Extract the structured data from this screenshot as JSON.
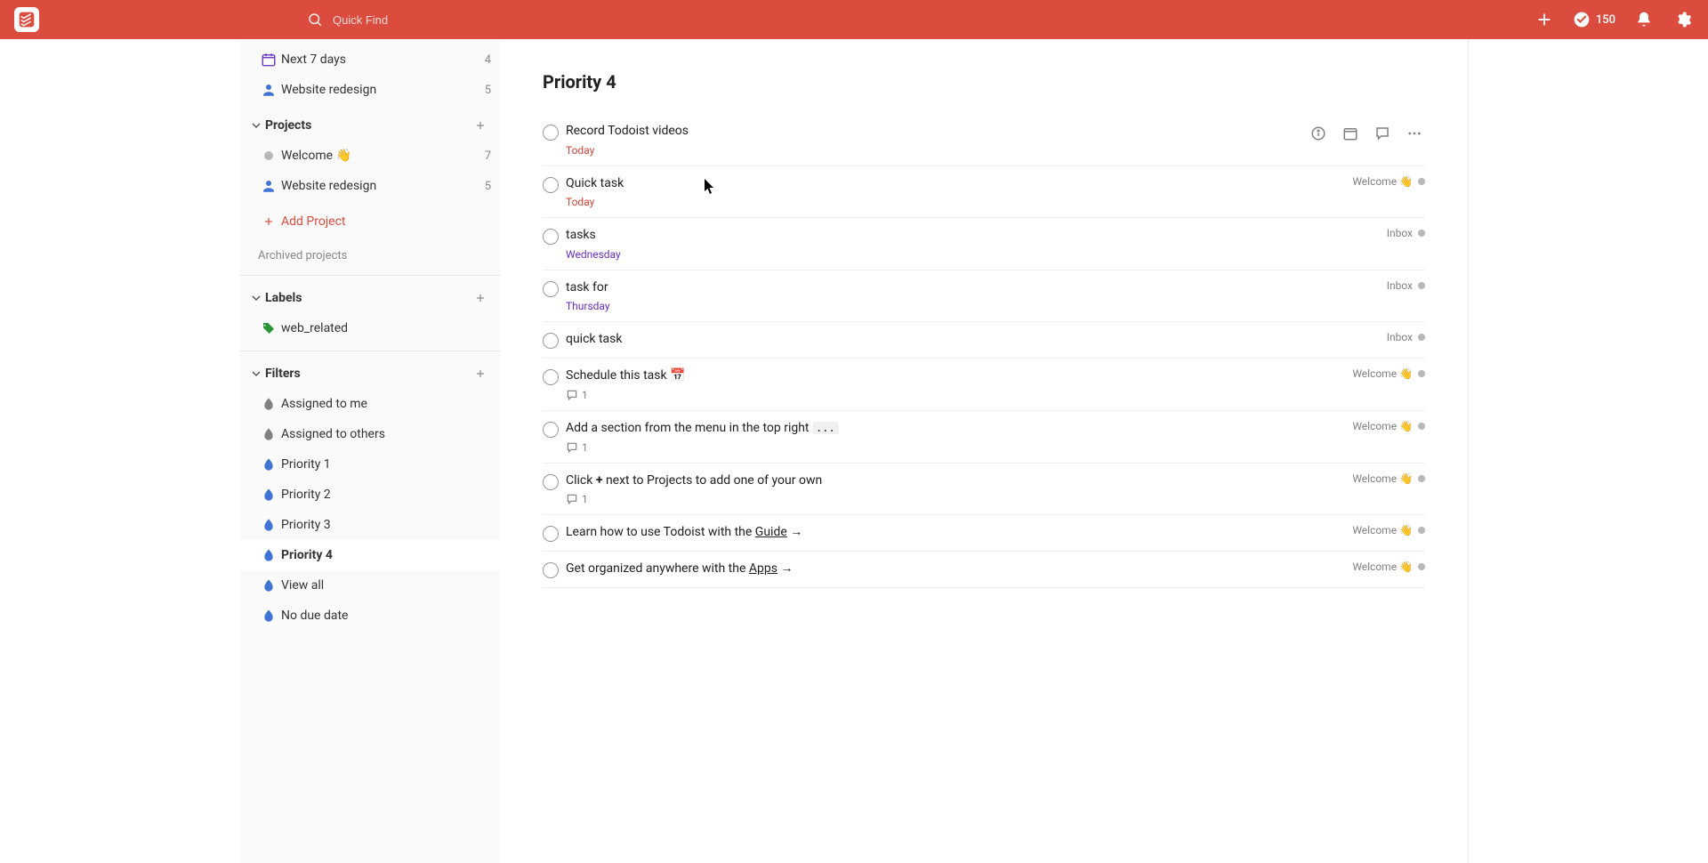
{
  "topbar": {
    "search_placeholder": "Quick Find",
    "karma_count": "150"
  },
  "sidebar": {
    "top_items": [
      {
        "kind": "days",
        "label": "Next 7 days",
        "count": "4"
      },
      {
        "kind": "shared",
        "label": "Website redesign",
        "count": "5"
      }
    ],
    "projects_header": "Projects",
    "projects": [
      {
        "label": "Welcome 👋",
        "count": "7",
        "dot": true
      },
      {
        "label": "Website redesign",
        "count": "5",
        "shared": true
      }
    ],
    "add_project_label": "Add Project",
    "archived_label": "Archived projects",
    "labels_header": "Labels",
    "labels": [
      {
        "label": "web_related"
      }
    ],
    "filters_header": "Filters",
    "filters": [
      {
        "label": "Assigned to me",
        "color": "gray"
      },
      {
        "label": "Assigned to others",
        "color": "gray"
      },
      {
        "label": "Priority 1",
        "color": "blue"
      },
      {
        "label": "Priority 2",
        "color": "blue"
      },
      {
        "label": "Priority 3",
        "color": "blue"
      },
      {
        "label": "Priority 4",
        "color": "blue",
        "active": true
      },
      {
        "label": "View all",
        "color": "blue"
      },
      {
        "label": "No due date",
        "color": "blue"
      }
    ]
  },
  "main": {
    "title": "Priority 4",
    "welcome_label": "Welcome 👋",
    "inbox_label": "Inbox",
    "tasks": [
      {
        "title": "Record Todoist videos",
        "due": "Today",
        "due_kind": "today",
        "hover": true
      },
      {
        "title": "Quick task",
        "due": "Today",
        "due_kind": "today",
        "project": "welcome"
      },
      {
        "title": "tasks",
        "due": "Wednesday",
        "due_kind": "upcoming",
        "project": "inbox"
      },
      {
        "title": "task for",
        "due": "Thursday",
        "due_kind": "upcoming",
        "project": "inbox"
      },
      {
        "title": "quick task",
        "project": "inbox"
      },
      {
        "title": "Schedule this task 📅",
        "comments": "1",
        "project": "welcome"
      },
      {
        "title_rich": "add_section",
        "plain": "Add a section from the menu in the top right ...",
        "comments": "1",
        "project": "welcome"
      },
      {
        "title_rich": "click_plus",
        "plain": "Click + next to Projects to add one of your own",
        "comments": "1",
        "project": "welcome"
      },
      {
        "title_rich": "learn_guide",
        "plain": "Learn how to use Todoist with the Guide →",
        "project": "welcome"
      },
      {
        "title_rich": "get_apps",
        "plain": "Get organized anywhere with the Apps →",
        "project": "welcome"
      }
    ],
    "rich": {
      "add_section_prefix": "Add a section from the menu in the top right ",
      "add_section_code": "...",
      "click_plus_1": "Click ",
      "click_plus_bold": "+",
      "click_plus_2": " next to Projects to add one of your own",
      "learn_guide_1": "Learn how to use Todoist with the ",
      "learn_guide_link": "Guide",
      "learn_guide_2": " →",
      "get_apps_1": "Get organized anywhere with the ",
      "get_apps_link": "Apps",
      "get_apps_2": " →"
    }
  }
}
